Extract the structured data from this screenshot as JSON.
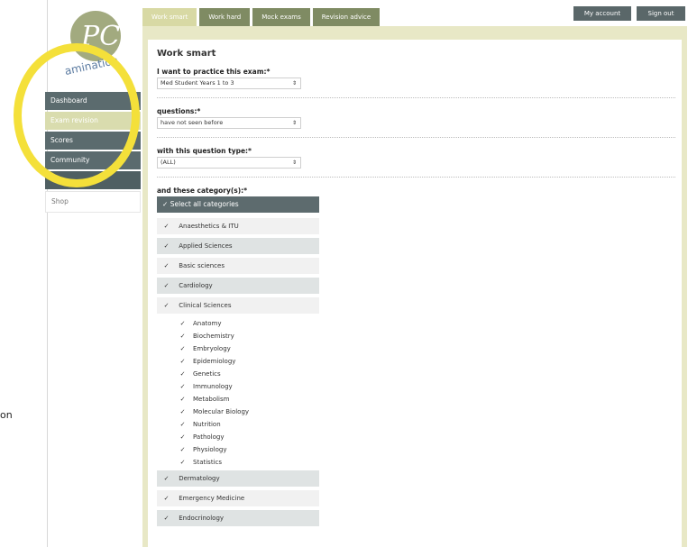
{
  "stray_text": "on",
  "nav": {
    "tabs": [
      "Work smart",
      "Work hard",
      "Mock exams",
      "Revision advice"
    ],
    "account_label": "My account",
    "signout_label": "Sign out"
  },
  "sidebar": {
    "items": [
      "Dashboard",
      "Exam revision",
      "Scores",
      "Community",
      "",
      "Shop"
    ]
  },
  "main": {
    "title": "Work smart",
    "q1_label": "I want to practice this exam:*",
    "q1_value": "Med Student Years 1 to 3",
    "q2_label": "questions:*",
    "q2_value": "have not seen before",
    "q3_label": "with this question type:*",
    "q3_value": "(ALL)",
    "q4_label": "and these category(s):*",
    "select_all": "Select all categories",
    "categories": [
      "Anaesthetics & ITU",
      "Applied Sciences",
      "Basic sciences",
      "Cardiology",
      "Clinical Sciences"
    ],
    "sub_categories": [
      "Anatomy",
      "Biochemistry",
      "Embryology",
      "Epidemiology",
      "Genetics",
      "Immunology",
      "Metabolism",
      "Molecular Biology",
      "Nutrition",
      "Pathology",
      "Physiology",
      "Statistics"
    ],
    "categories_after": [
      "Dermatology",
      "Emergency Medicine",
      "Endocrinology"
    ]
  },
  "icons": {
    "checkbox": "✓",
    "select_arrow": "⇕"
  },
  "colors": {
    "accent": "#7f8b63",
    "highlight": "#f4e03a",
    "dark": "#5b6b6e"
  }
}
